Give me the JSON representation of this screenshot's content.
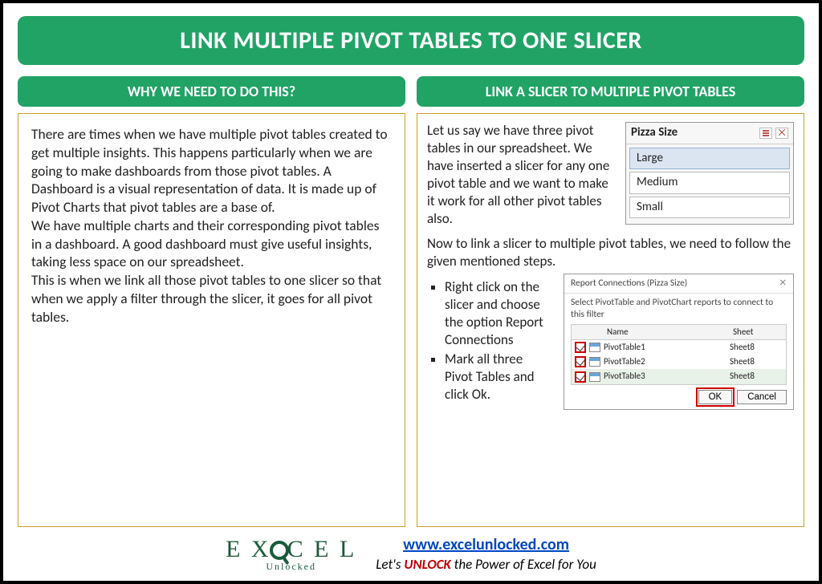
{
  "title": "LINK MULTIPLE PIVOT TABLES TO ONE SLICER",
  "left": {
    "heading": "WHY WE NEED TO DO THIS?",
    "p1": "There are times when we have multiple pivot tables created to get multiple insights. This happens particularly when we are going to make dashboards from those pivot tables. A Dashboard is a visual representation of data. It is made up of Pivot Charts that pivot tables are a base of.",
    "p2": "We have multiple charts and their corresponding pivot tables in a dashboard. A good dashboard must give useful insights, taking less space on our spreadsheet.",
    "p3": "This is when we link all those pivot tables to one slicer so that when we apply a filter through the slicer, it goes for all pivot tables."
  },
  "right": {
    "heading": "LINK A SLICER TO MULTIPLE PIVOT TABLES",
    "intro": "Let us say we have three pivot tables in our spreadsheet. We have inserted a slicer for any one pivot table and we want to make it work for all other pivot tables also.",
    "slicer": {
      "title": "Pizza Size",
      "items": [
        "Large",
        "Medium",
        "Small"
      ]
    },
    "mid": "Now to link a slicer to multiple pivot tables, we need to follow the given mentioned steps.",
    "steps": [
      "Right click on the slicer and choose the option Report Connections",
      "Mark all three Pivot Tables and click Ok."
    ],
    "dialog": {
      "title": "Report Connections (Pizza Size)",
      "subtitle": "Select PivotTable and PivotChart reports to connect to this filter",
      "col_name": "Name",
      "col_sheet": "Sheet",
      "rows": [
        {
          "name": "PivotTable1",
          "sheet": "Sheet8"
        },
        {
          "name": "PivotTable2",
          "sheet": "Sheet8"
        },
        {
          "name": "PivotTable3",
          "sheet": "Sheet8"
        }
      ],
      "ok": "OK",
      "cancel": "Cancel"
    }
  },
  "footer": {
    "logo_top": "E X C E L",
    "logo_sub": "Unlocked",
    "url": "www.excelunlocked.com",
    "tagline_pre": "Let's ",
    "tagline_em": "UNLOCK",
    "tagline_post": " the Power of Excel for You"
  }
}
